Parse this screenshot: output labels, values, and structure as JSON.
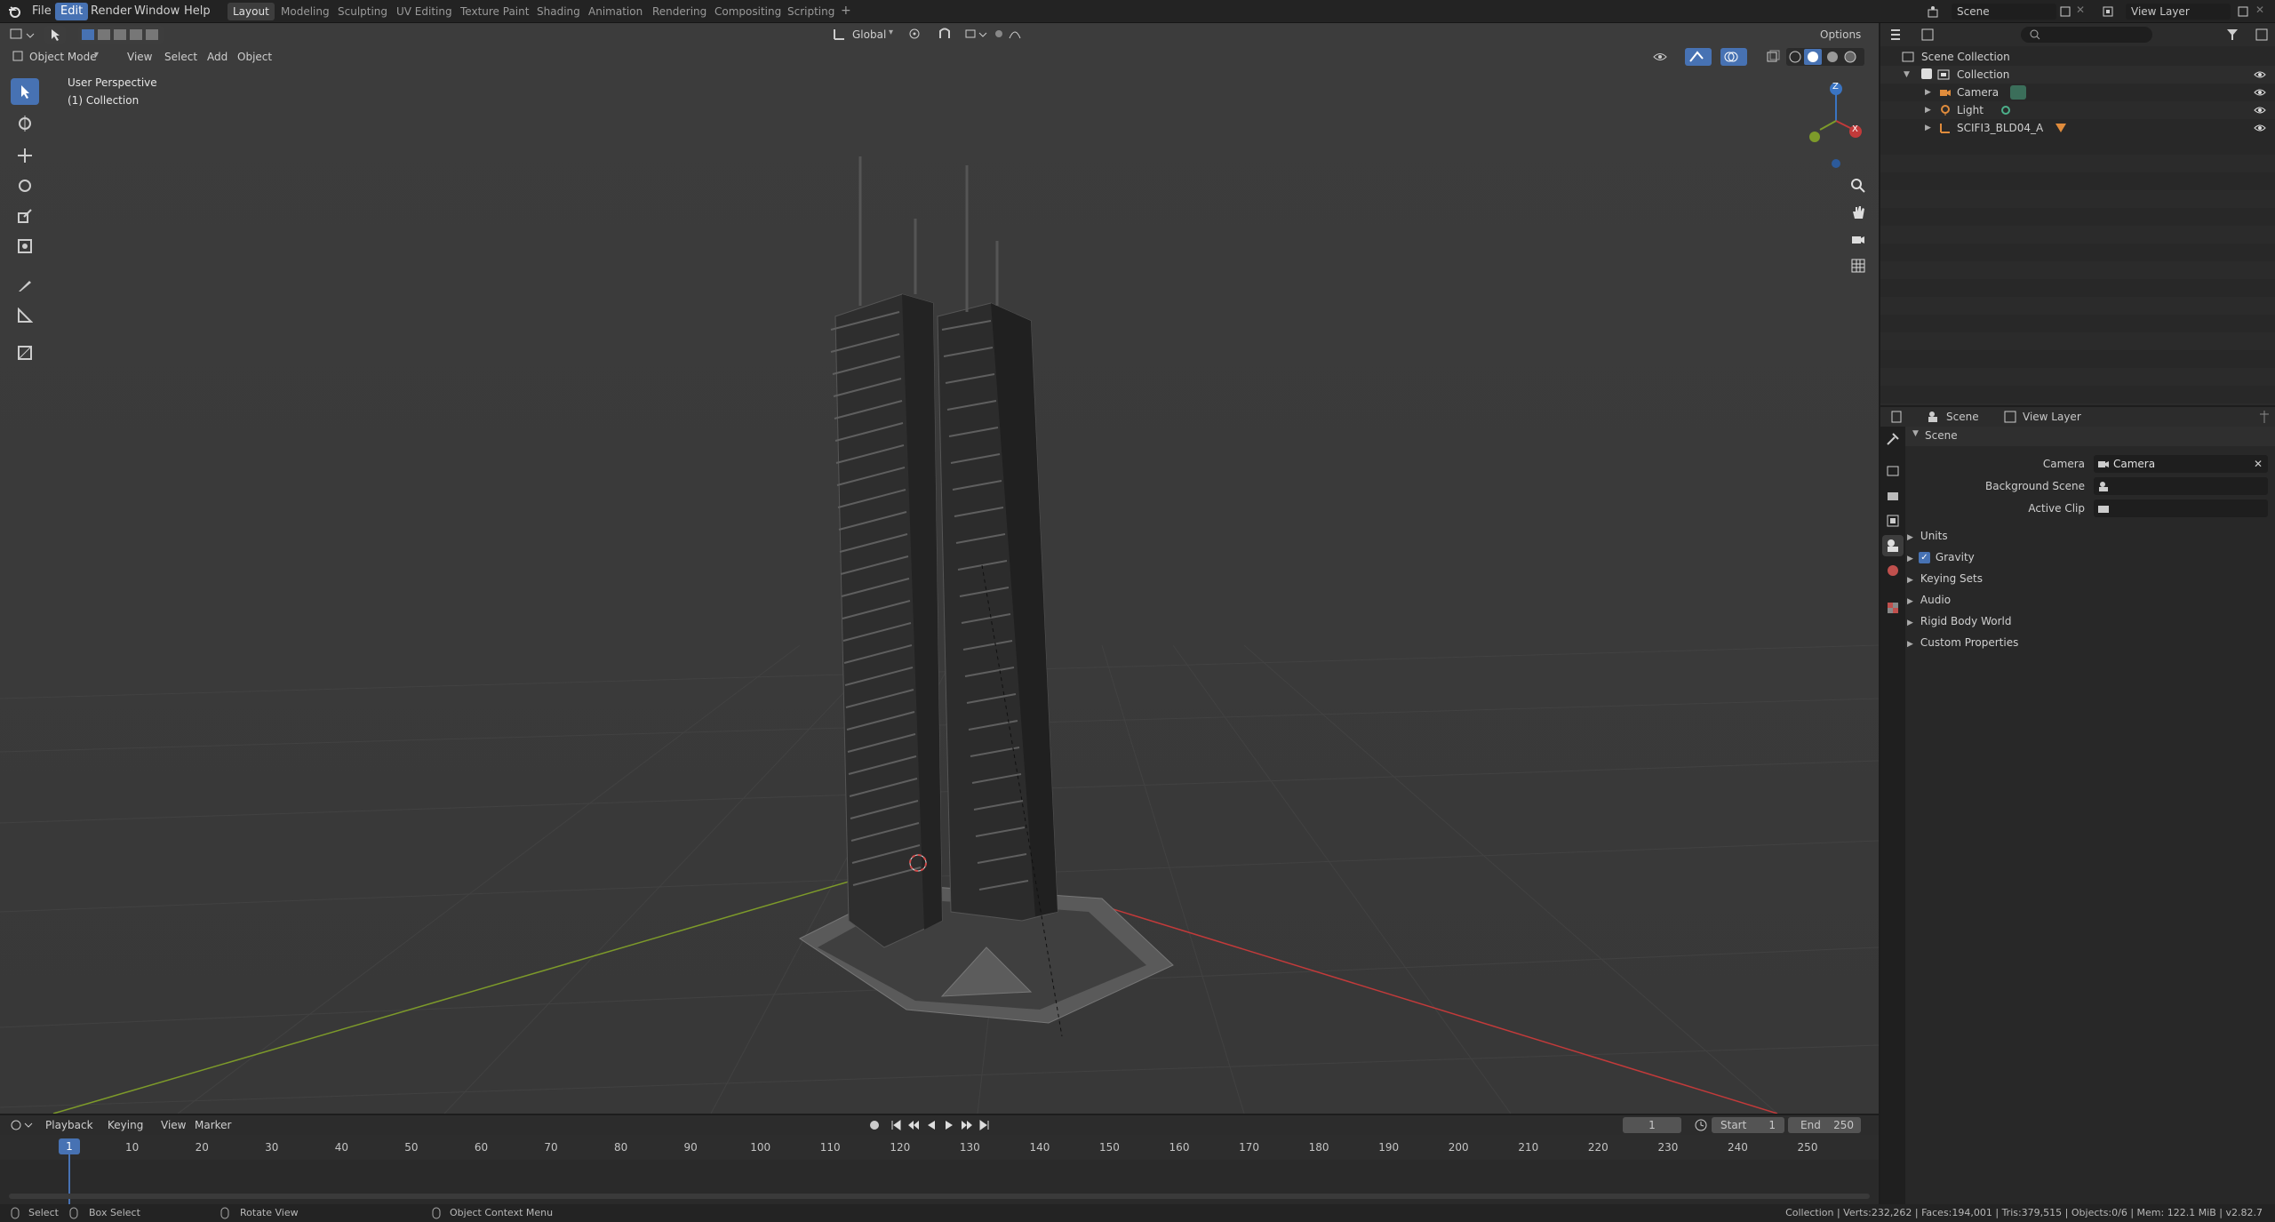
{
  "menu": [
    "File",
    "Edit",
    "Render",
    "Window",
    "Help"
  ],
  "menu_active": "Edit",
  "workspaces": [
    "Layout",
    "Modeling",
    "Sculpting",
    "UV Editing",
    "Texture Paint",
    "Shading",
    "Animation",
    "Rendering",
    "Compositing",
    "Scripting"
  ],
  "workspace_active": "Layout",
  "scene_name": "Scene",
  "view_layer": "View Layer",
  "viewport": {
    "mode": "Object Mode",
    "menus": [
      "View",
      "Select",
      "Add",
      "Object"
    ],
    "orientation": "Global",
    "options": "Options",
    "info_line1": "User Perspective",
    "info_line2": "(1) Collection",
    "gizmo": {
      "x": "X",
      "y": "Y",
      "z": "Z"
    }
  },
  "outliner": {
    "root": "Scene Collection",
    "items": [
      {
        "name": "Collection",
        "kind": "collection"
      },
      {
        "name": "Camera",
        "kind": "camera"
      },
      {
        "name": "Light",
        "kind": "light"
      },
      {
        "name": "SCIFI3_BLD04_A",
        "kind": "empty"
      }
    ]
  },
  "properties": {
    "tab_scene": "Scene",
    "tab_view_layer": "View Layer",
    "panel": "Scene",
    "camera_label": "Camera",
    "camera_value": "Camera",
    "bg_scene_label": "Background Scene",
    "active_clip_label": "Active Clip",
    "sections": [
      "Units",
      "Gravity",
      "Keying Sets",
      "Audio",
      "Rigid Body World",
      "Custom Properties"
    ],
    "gravity_checked": true
  },
  "timeline": {
    "menus": [
      "Playback",
      "Keying",
      "View",
      "Marker"
    ],
    "current_frame": "1",
    "start_label": "Start",
    "start": "1",
    "end_label": "End",
    "end": "250",
    "ticks": [
      "1",
      "10",
      "20",
      "30",
      "40",
      "50",
      "60",
      "70",
      "80",
      "90",
      "100",
      "110",
      "120",
      "130",
      "140",
      "150",
      "160",
      "170",
      "180",
      "190",
      "200",
      "210",
      "220",
      "230",
      "240",
      "250"
    ]
  },
  "statusbar": {
    "select": "Select",
    "box_select": "Box Select",
    "rotate": "Rotate View",
    "context": "Object Context Menu",
    "stats": "Collection | Verts:232,262 | Faces:194,001 | Tris:379,515 | Objects:0/6 | Mem: 122.1 MiB | v2.82.7"
  },
  "colors": {
    "accent": "#4772b3",
    "x_axis": "#c23a3a",
    "y_axis": "#7d9a2a",
    "z_axis": "#3a74c2"
  }
}
